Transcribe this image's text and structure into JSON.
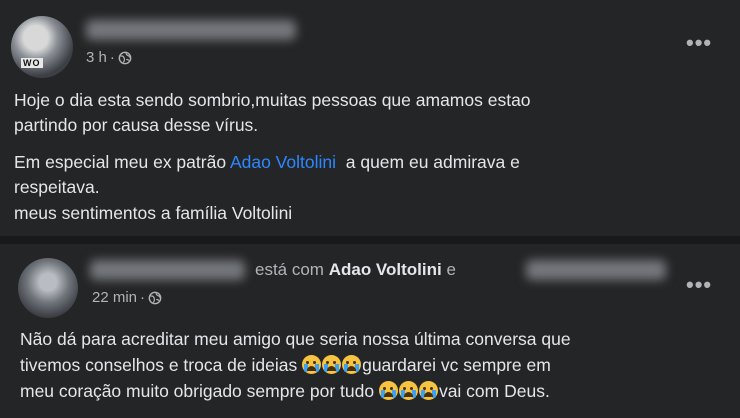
{
  "post1": {
    "time": "3 h",
    "separator": "·",
    "menu": "•••",
    "line1": "Hoje o dia esta sendo sombrio,muitas pessoas que amamos estao",
    "line2": "partindo por causa desse vírus.",
    "line3_prefix": "Em especial meu ex patrão ",
    "line3_link": "Adao Voltolini",
    "line3_suffix": "  a quem eu admirava e",
    "line4": "respeitava.",
    "line5": "meus sentimentos a família Voltolini"
  },
  "post2": {
    "with_text": "está com ",
    "tagged": "Adao Voltolini",
    "and_text": " e",
    "time": "22 min",
    "separator": "·",
    "menu": "•••",
    "line1": "Não dá para acreditar meu amigo que seria nossa última conversa que",
    "line2_prefix": "tivemos conselhos e troca de ideias ",
    "line2_suffix": "guardarei vc sempre em",
    "line3_prefix": "meu coração muito obrigado sempre por tudo ",
    "line3_suffix": "vai com Deus.",
    "emoji_name": "crying-face-emoji"
  },
  "colors": {
    "background": "#18191a",
    "card": "#242526",
    "link": "#2d88ff",
    "secondary_text": "#b0b3b8"
  }
}
